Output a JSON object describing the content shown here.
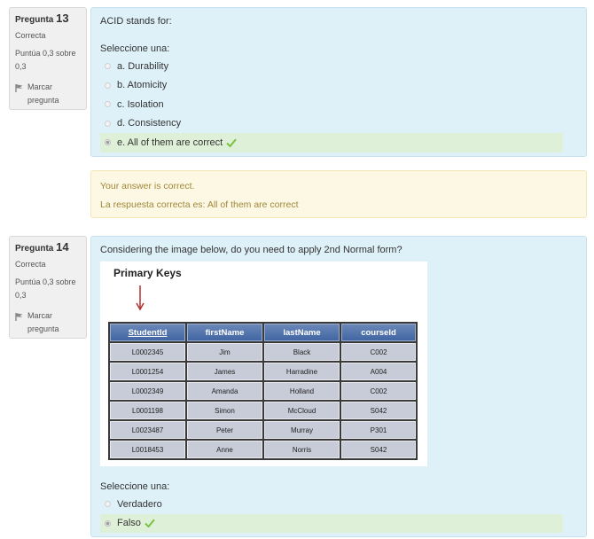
{
  "q13": {
    "label": "Pregunta",
    "number": "13",
    "status": "Correcta",
    "grade": "Puntúa 0,3 sobre 0,3",
    "flag": "Marcar pregunta",
    "text": "ACID stands for:",
    "prompt": "Seleccione una:",
    "options": [
      {
        "label": "a. Durability"
      },
      {
        "label": "b. Atomicity"
      },
      {
        "label": "c. Isolation"
      },
      {
        "label": "d. Consistency"
      },
      {
        "label": "e. All of them are correct"
      }
    ],
    "selected_option": "e. All of them are correct"
  },
  "feedback13": {
    "line1": "Your answer is correct.",
    "line2": "La respuesta correcta es: All of them are correct"
  },
  "q14": {
    "label": "Pregunta",
    "number": "14",
    "status": "Correcta",
    "grade": "Puntúa 0,3 sobre 0,3",
    "flag": "Marcar pregunta",
    "text": "Considering the image below, do you need to apply 2nd Normal form?",
    "figure": {
      "title": "Primary Keys",
      "columns": [
        "StudentId",
        "firstName",
        "lastName",
        "courseId"
      ],
      "rows": [
        [
          "L0002345",
          "Jim",
          "Black",
          "C002"
        ],
        [
          "L0001254",
          "James",
          "Harradine",
          "A004"
        ],
        [
          "L0002349",
          "Amanda",
          "Holland",
          "C002"
        ],
        [
          "L0001198",
          "Simon",
          "McCloud",
          "S042"
        ],
        [
          "L0023487",
          "Peter",
          "Murray",
          "P301"
        ],
        [
          "L0018453",
          "Anne",
          "Norris",
          "S042"
        ]
      ]
    },
    "prompt": "Seleccione una:",
    "options": [
      {
        "label": "Verdadero"
      },
      {
        "label": "Falso"
      }
    ],
    "selected_option": "Falso"
  },
  "colors": {
    "content_bg": "#def0f8",
    "correct_bg": "#dff0d8",
    "feedback_bg": "#fcf8e3",
    "check": "#7cc243"
  },
  "icons": [
    "flag-icon",
    "checkmark-icon",
    "down-arrow-icon"
  ]
}
